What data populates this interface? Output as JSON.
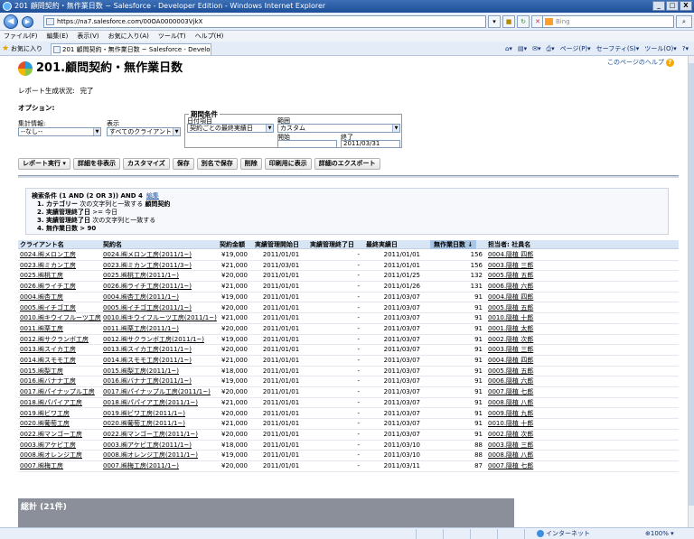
{
  "window": {
    "title": "201 顧問契約・無作業日数 ~ Salesforce - Developer Edition - Windows Internet Explorer",
    "min": "_",
    "max": "□",
    "close": "X"
  },
  "browser": {
    "url": "https://na7.salesforce.com/00OA0000003VjkX",
    "search_placeholder": "Bing",
    "menu": [
      "ファイル(F)",
      "編集(E)",
      "表示(V)",
      "お気に入り(A)",
      "ツール(T)",
      "ヘルプ(H)"
    ],
    "favorites_label": "お気に入り",
    "tab_title": "201 顧問契約・無作業日数 ~ Salesforce - Develope...",
    "commands": [
      "ページ(P)▾",
      "セーフティ(S)▾",
      "ツール(O)▾"
    ],
    "status_zone": "インターネット",
    "zoom": "100%"
  },
  "page": {
    "help_link": "このページのヘルプ",
    "title": "201.顧問契約・無作業日数",
    "run_status_label": "レポート生成状況:",
    "run_status_value": "完了",
    "options_label": "オプション:",
    "summarize_label": "集計情報:",
    "summarize_value": "--なし--",
    "show_label": "表示",
    "show_value": "すべてのクライアント",
    "period_legend": "期間条件",
    "date_field_label": "日付項目",
    "date_field_value": "契約ごとの最終実績日",
    "range_label": "範囲",
    "range_value": "カスタム",
    "start_label": "開始",
    "start_value": "",
    "end_label": "終了",
    "end_value": "2011/03/31"
  },
  "buttons": [
    "レポート実行 ▾",
    "詳細を非表示",
    "カスタマイズ",
    "保存",
    "別名で保存",
    "削除",
    "印刷用に表示",
    "詳細のエクスポート"
  ],
  "filters": {
    "header": "検索条件 (1 AND (2 OR 3)) AND 4",
    "edit": "編集",
    "lines": [
      {
        "field": "1. カテゴリー",
        "op": "次の文字列と一致する",
        "value": "顧問契約"
      },
      {
        "field": "2. 実績管理終了日",
        "op": ">= 今日",
        "value": ""
      },
      {
        "field": "3. 実績管理終了日",
        "op": "次の文字列と一致する",
        "value": ""
      },
      {
        "field": "4. 無作業日数",
        "op": "> 90",
        "value": ""
      }
    ]
  },
  "table": {
    "columns": [
      "クライアント名",
      "契約名",
      "契約金額",
      "実績管理開始日",
      "実績管理終了日",
      "最終実績日",
      "無作業日数 ↓",
      "担当者: 社員名"
    ],
    "rows": [
      [
        "0024.㈱メロン工房",
        "0024.㈱メロン工房(2011/1~)",
        "¥19,000",
        "2011/01/01",
        "-",
        "2011/01/01",
        "156",
        "0004.隠植 四郎"
      ],
      [
        "0023.㈱ミカン工房",
        "0023.㈱ミカン工房(2011/3~)",
        "¥21,000",
        "2011/03/01",
        "-",
        "2011/01/01",
        "156",
        "0003.隠植 三郎"
      ],
      [
        "0025.㈱桃工房",
        "0025.㈱桃工房(2011/1~)",
        "¥20,000",
        "2011/01/01",
        "-",
        "2011/01/25",
        "132",
        "0005.隠植 五郎"
      ],
      [
        "0026.㈱ライチ工房",
        "0026.㈱ライチ工房(2011/1~)",
        "¥21,000",
        "2011/01/01",
        "-",
        "2011/01/26",
        "131",
        "0006.隠植 六郎"
      ],
      [
        "0004.㈱杏工房",
        "0004.㈱杏工房(2011/1~)",
        "¥19,000",
        "2011/01/01",
        "-",
        "2011/03/07",
        "91",
        "0004.隠植 四郎"
      ],
      [
        "0005.㈱イチゴ工房",
        "0005.㈱イチゴ工房(2011/1~)",
        "¥20,000",
        "2011/01/01",
        "-",
        "2011/03/07",
        "91",
        "0005.隠植 五郎"
      ],
      [
        "0010.㈱キウイフルーツ工房",
        "0010.㈱キウイフルーツ工房(2011/1~)",
        "¥21,000",
        "2011/01/01",
        "-",
        "2011/03/07",
        "91",
        "0010.隠植 十郎"
      ],
      [
        "0011.㈱栗工房",
        "0011.㈱栗工房(2011/1~)",
        "¥20,000",
        "2011/01/01",
        "-",
        "2011/03/07",
        "91",
        "0001.隠植 太郎"
      ],
      [
        "0012.㈱サクランボ工房",
        "0012.㈱サクランボ工房(2011/1~)",
        "¥19,000",
        "2011/01/01",
        "-",
        "2011/03/07",
        "91",
        "0002.隠植 次郎"
      ],
      [
        "0013.㈱スイカ工房",
        "0013.㈱スイカ工房(2011/1~)",
        "¥20,000",
        "2011/01/01",
        "-",
        "2011/03/07",
        "91",
        "0003.隠植 三郎"
      ],
      [
        "0014.㈱スモモ工房",
        "0014.㈱スモモ工房(2011/1~)",
        "¥21,000",
        "2011/01/01",
        "-",
        "2011/03/07",
        "91",
        "0004.隠植 四郎"
      ],
      [
        "0015.㈱梨工房",
        "0015.㈱梨工房(2011/1~)",
        "¥18,000",
        "2011/01/01",
        "-",
        "2011/03/07",
        "91",
        "0005.隠植 五郎"
      ],
      [
        "0016.㈱バナナ工房",
        "0016.㈱バナナ工房(2011/1~)",
        "¥19,000",
        "2011/01/01",
        "-",
        "2011/03/07",
        "91",
        "0006.隠植 六郎"
      ],
      [
        "0017.㈱パイナップル工房",
        "0017.㈱パイナップル工房(2011/1~)",
        "¥20,000",
        "2011/01/01",
        "-",
        "2011/03/07",
        "91",
        "0007.隠植 七郎"
      ],
      [
        "0018.㈱パパイア工房",
        "0018.㈱パパイア工房(2011/1~)",
        "¥21,000",
        "2011/01/01",
        "-",
        "2011/03/07",
        "91",
        "0008.隠植 八郎"
      ],
      [
        "0019.㈱ビワ工房",
        "0019.㈱ビワ工房(2011/1~)",
        "¥20,000",
        "2011/01/01",
        "-",
        "2011/03/07",
        "91",
        "0009.隠植 九郎"
      ],
      [
        "0020.㈱葡萄工房",
        "0020.㈱葡萄工房(2011/1~)",
        "¥21,000",
        "2011/01/01",
        "-",
        "2011/03/07",
        "91",
        "0010.隠植 十郎"
      ],
      [
        "0022.㈱マンゴー工房",
        "0022.㈱マンゴー工房(2011/1~)",
        "¥20,000",
        "2011/01/01",
        "-",
        "2011/03/07",
        "91",
        "0002.隠植 次郎"
      ],
      [
        "0003.㈱アケビ工房",
        "0003.㈱アケビ工房(2011/1~)",
        "¥18,000",
        "2011/01/01",
        "-",
        "2011/03/10",
        "88",
        "0003.隠植 三郎"
      ],
      [
        "0008.㈱オレンジ工房",
        "0008.㈱オレンジ工房(2011/1~)",
        "¥19,000",
        "2011/01/01",
        "-",
        "2011/03/10",
        "88",
        "0008.隠植 八郎"
      ],
      [
        "0007.㈱梅工房",
        "0007.㈱梅工房(2011/1~)",
        "¥20,000",
        "2011/01/01",
        "-",
        "2011/03/11",
        "87",
        "0007.隠植 七郎"
      ]
    ],
    "total": "総計 (21件)"
  }
}
